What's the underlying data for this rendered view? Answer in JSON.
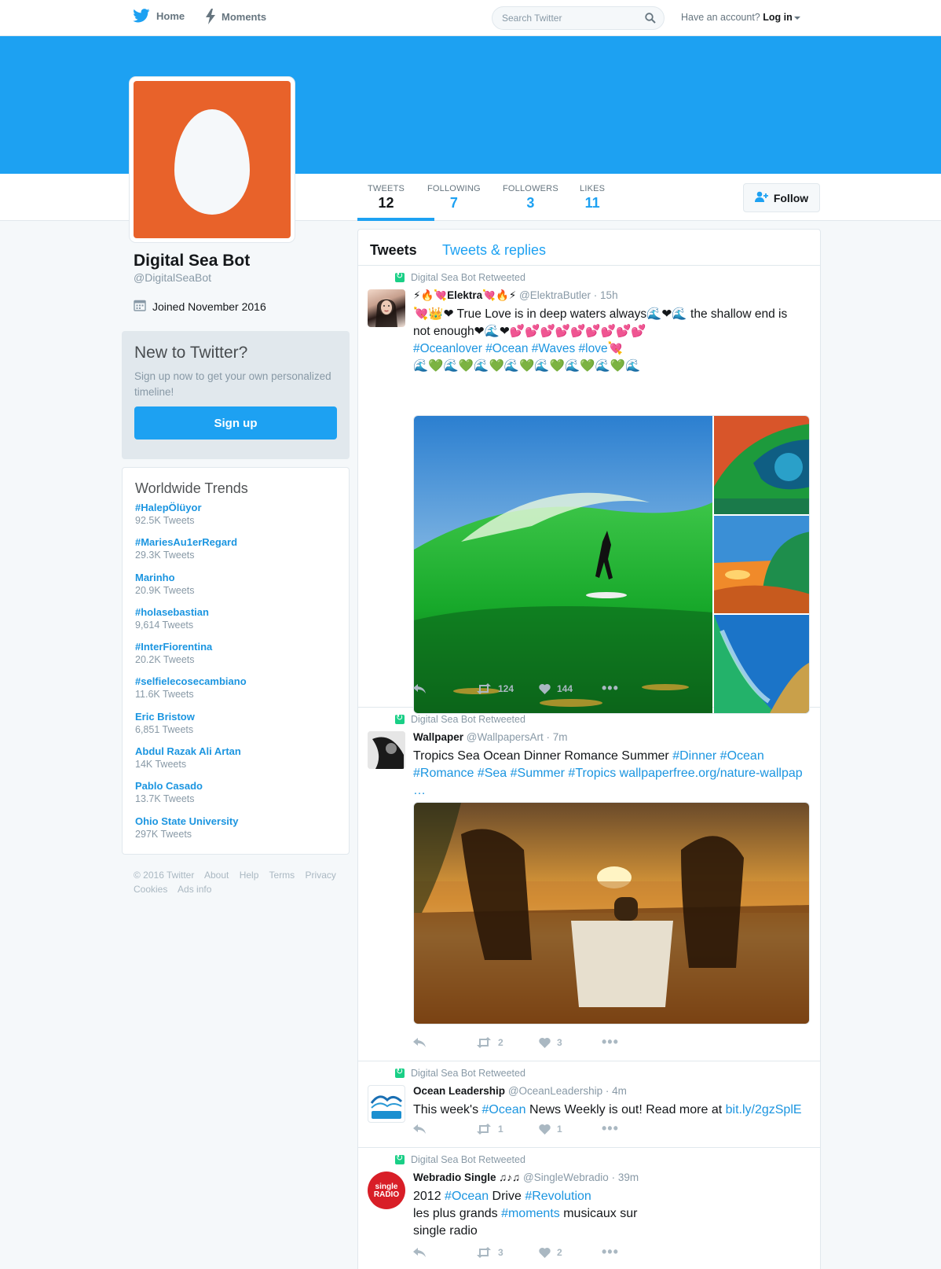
{
  "nav": {
    "home": "Home",
    "moments": "Moments",
    "search_placeholder": "Search Twitter",
    "account_question": "Have an account?",
    "login": "Log in"
  },
  "profile": {
    "name": "Digital Sea Bot",
    "handle": "@DigitalSeaBot",
    "joined": "Joined November 2016",
    "follow_label": "Follow",
    "avatar_color": "#e8622a",
    "banner_color": "#1da1f2",
    "stats": [
      {
        "label": "TWEETS",
        "value": "12"
      },
      {
        "label": "FOLLOWING",
        "value": "7"
      },
      {
        "label": "FOLLOWERS",
        "value": "3"
      },
      {
        "label": "LIKES",
        "value": "11"
      }
    ]
  },
  "signup": {
    "title": "New to Twitter?",
    "text": "Sign up now to get your own personalized timeline!",
    "button": "Sign up"
  },
  "trends": {
    "title": "Worldwide Trends",
    "items": [
      {
        "name": "#HalepÖlüyor",
        "count": "92.5K Tweets"
      },
      {
        "name": "#MariesAu1erRegard",
        "count": "29.3K Tweets"
      },
      {
        "name": "Marinho",
        "count": "20.9K Tweets"
      },
      {
        "name": "#holasebastian",
        "count": "9,614 Tweets"
      },
      {
        "name": "#InterFiorentina",
        "count": "20.2K Tweets"
      },
      {
        "name": "#selfielecosecambiano",
        "count": "11.6K Tweets"
      },
      {
        "name": "Eric Bristow",
        "count": "6,851 Tweets"
      },
      {
        "name": "Abdul Razak Ali Artan",
        "count": "14K Tweets"
      },
      {
        "name": "Pablo Casado",
        "count": "13.7K Tweets"
      },
      {
        "name": "Ohio State University",
        "count": "297K Tweets"
      }
    ]
  },
  "footer": [
    "© 2016 Twitter",
    "About",
    "Help",
    "Terms",
    "Privacy",
    "Cookies",
    "Ads info"
  ],
  "timeline": {
    "tabs": [
      "Tweets",
      "Tweets & replies"
    ],
    "retweet_label": "Digital Sea Bot Retweeted",
    "tweets": [
      {
        "author": "Elektra",
        "author_prefix": "⚡🔥💘",
        "author_suffix": "💘🔥⚡",
        "handle": "@ElektraButler",
        "time": "15h",
        "text_1": "💘👑❤ True Love is in deep waters always🌊❤🌊 the shallow end is not enough❤🌊❤💕💕💕💕💕💕💕💕💕",
        "tags": "#Oceanlover #Ocean #Waves #love💘",
        "emoji_line": "🌊💚🌊💚🌊💚🌊💚🌊💚🌊💚🌊💚🌊",
        "retweets": "124",
        "likes": "144"
      },
      {
        "author": "Wallpaper",
        "handle": "@WallpapersArt",
        "time": "7m",
        "text_plain": "Tropics Sea Ocean Dinner Romance Summer ",
        "text_tags": "#Dinner #Ocean #Romance #Sea #Summer #Tropics wallpaperfree.org/nature-wallpap …",
        "retweets": "2",
        "likes": "3"
      },
      {
        "author": "Ocean Leadership",
        "handle": "@OceanLeadership",
        "time": "4m",
        "text_a": "This week's ",
        "text_tag": "#Ocean",
        "text_b": " News Weekly is out! Read more at ",
        "text_link": "bit.ly/2gzSplE",
        "retweets": "1",
        "likes": "1"
      },
      {
        "author": "Webradio Single ♫♪♫",
        "handle": "@SingleWebradio",
        "time": "39m",
        "line1_a": "2012 ",
        "line1_tag1": "#Ocean",
        "line1_b": " Drive ",
        "line1_tag2": "#Revolution",
        "line2_a": "les plus grands ",
        "line2_tag": "#moments",
        "line2_b": " musicaux sur",
        "line3": "single radio",
        "retweets": "3",
        "likes": "2"
      }
    ]
  }
}
